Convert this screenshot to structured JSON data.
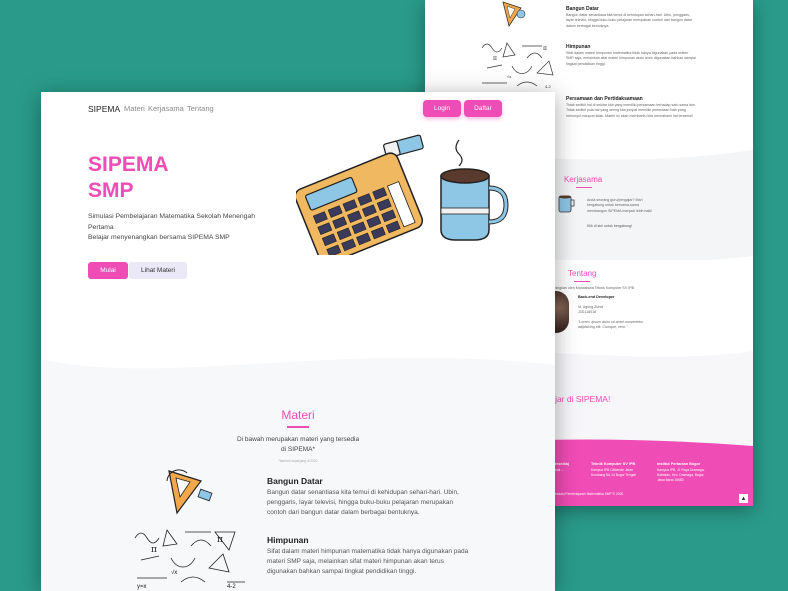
{
  "nav": {
    "brand": "SIPEMA",
    "links": [
      "Materi",
      "Kerjasama",
      "Tentang"
    ],
    "login": "Login",
    "daftar": "Daftar"
  },
  "hero": {
    "title_line1": "SIPEMA",
    "title_line2": "SMP",
    "subtitle_line1": "Simulasi Pembelajaran Matematika Sekolah Menengah Pertama",
    "subtitle_line2": "Belajar menyenangkan bersama SIPEMA SMP",
    "btn_mulai": "Mulai",
    "btn_lihat": "Lihat Materi"
  },
  "materi": {
    "title": "Materi",
    "desc_line1": "Di bawah merupakan materi yang tersedia",
    "desc_line2": "di SIPEMA*",
    "note": "*tambah sepanjang di 2020",
    "items": [
      {
        "title": "Bangun Datar",
        "text": "Bangun datar senantiasa kita temui di kehidupan sehari-hari. Ubin, penggaris, layar televisi, hingga buku-buku pelajaran merupakan contoh dari bangun datar dalam berbagai bentuknya."
      },
      {
        "title": "Himpunan",
        "text": "Sifat dalam materi himpunan matematika tidak hanya digunakan pada materi SMP saja, melainkan sifat materi himpunan akan terus digunakan bahkan sampai tingkat pendidikan tinggi."
      }
    ]
  },
  "back": {
    "items": [
      {
        "title": "Bangun Datar",
        "text": "Bangun datar senantiasa kita temui di kehidupan sehari-hari. Ubin, penggaris, layar televisi, hingga buku-buku pelajaran merupakan contoh dari bangun datar dalam berbagai bentuknya."
      },
      {
        "title": "Himpunan",
        "text": "Sifat dalam materi himpunan matematika tidak hanya digunakan pada materi SMP saja, melainkan sifat materi himpunan akan terus digunakan bahkan sampai tingkat pendidikan tinggi."
      },
      {
        "title": "Persamaan dan Pertidaksamaan",
        "text": "Tidak sedikit hal di sekitar kita yang memiliki persamaan terhadap satu sama lain. Tidak sedikit pula hal yang sering kita jumpai memiliki perbedaan baik yang menonjol maupun tidak. Materi ini akan membantu kita memahami hal tersebut!"
      }
    ],
    "kerjasama_title": "Kerjasama",
    "kerjasama_text": "Anda seorang guru/pengajar? Mari bergabung untuk bersama-sama membangun SIPEMA menjadi lebih baik!",
    "kerjasama_link": "Klik di sini untuk bergabung!",
    "tentang_title": "Tentang",
    "tentang_text": "Dikembangkan oleh Mahasiswa Teknik Komputer SV IPB",
    "role": "Back-end Developer",
    "person": "M. Agung Zuhdi",
    "nim": "J3D118018",
    "quote": "\"Lorem, ipsum dolor sit amet consectetur adipisicing elit. Cumque, vero.\"",
    "cta": "belajar di SIPEMA!",
    "footer": [
      {
        "title": "(tersedia)",
        "lines": [
          "Email ...",
          "..."
        ]
      },
      {
        "title": "Teknik Komputer SV IPB",
        "lines": [
          "Kampus IPB Cilibende Jalan",
          "Kumbang No.14 Bogor Tengah"
        ]
      },
      {
        "title": "Institut Pertanian Bogor",
        "lines": [
          "Kampus IPB, Jl. Raya Dramaga,",
          "Babakan, Kec. Dramaga, Bogor,",
          "Jawa Barat 16680"
        ]
      }
    ],
    "copyright": "Simulasi Pembelajaran Matematika SMP © 2020"
  },
  "colors": {
    "accent": "#f04cb5",
    "background": "#2a9b8a"
  }
}
